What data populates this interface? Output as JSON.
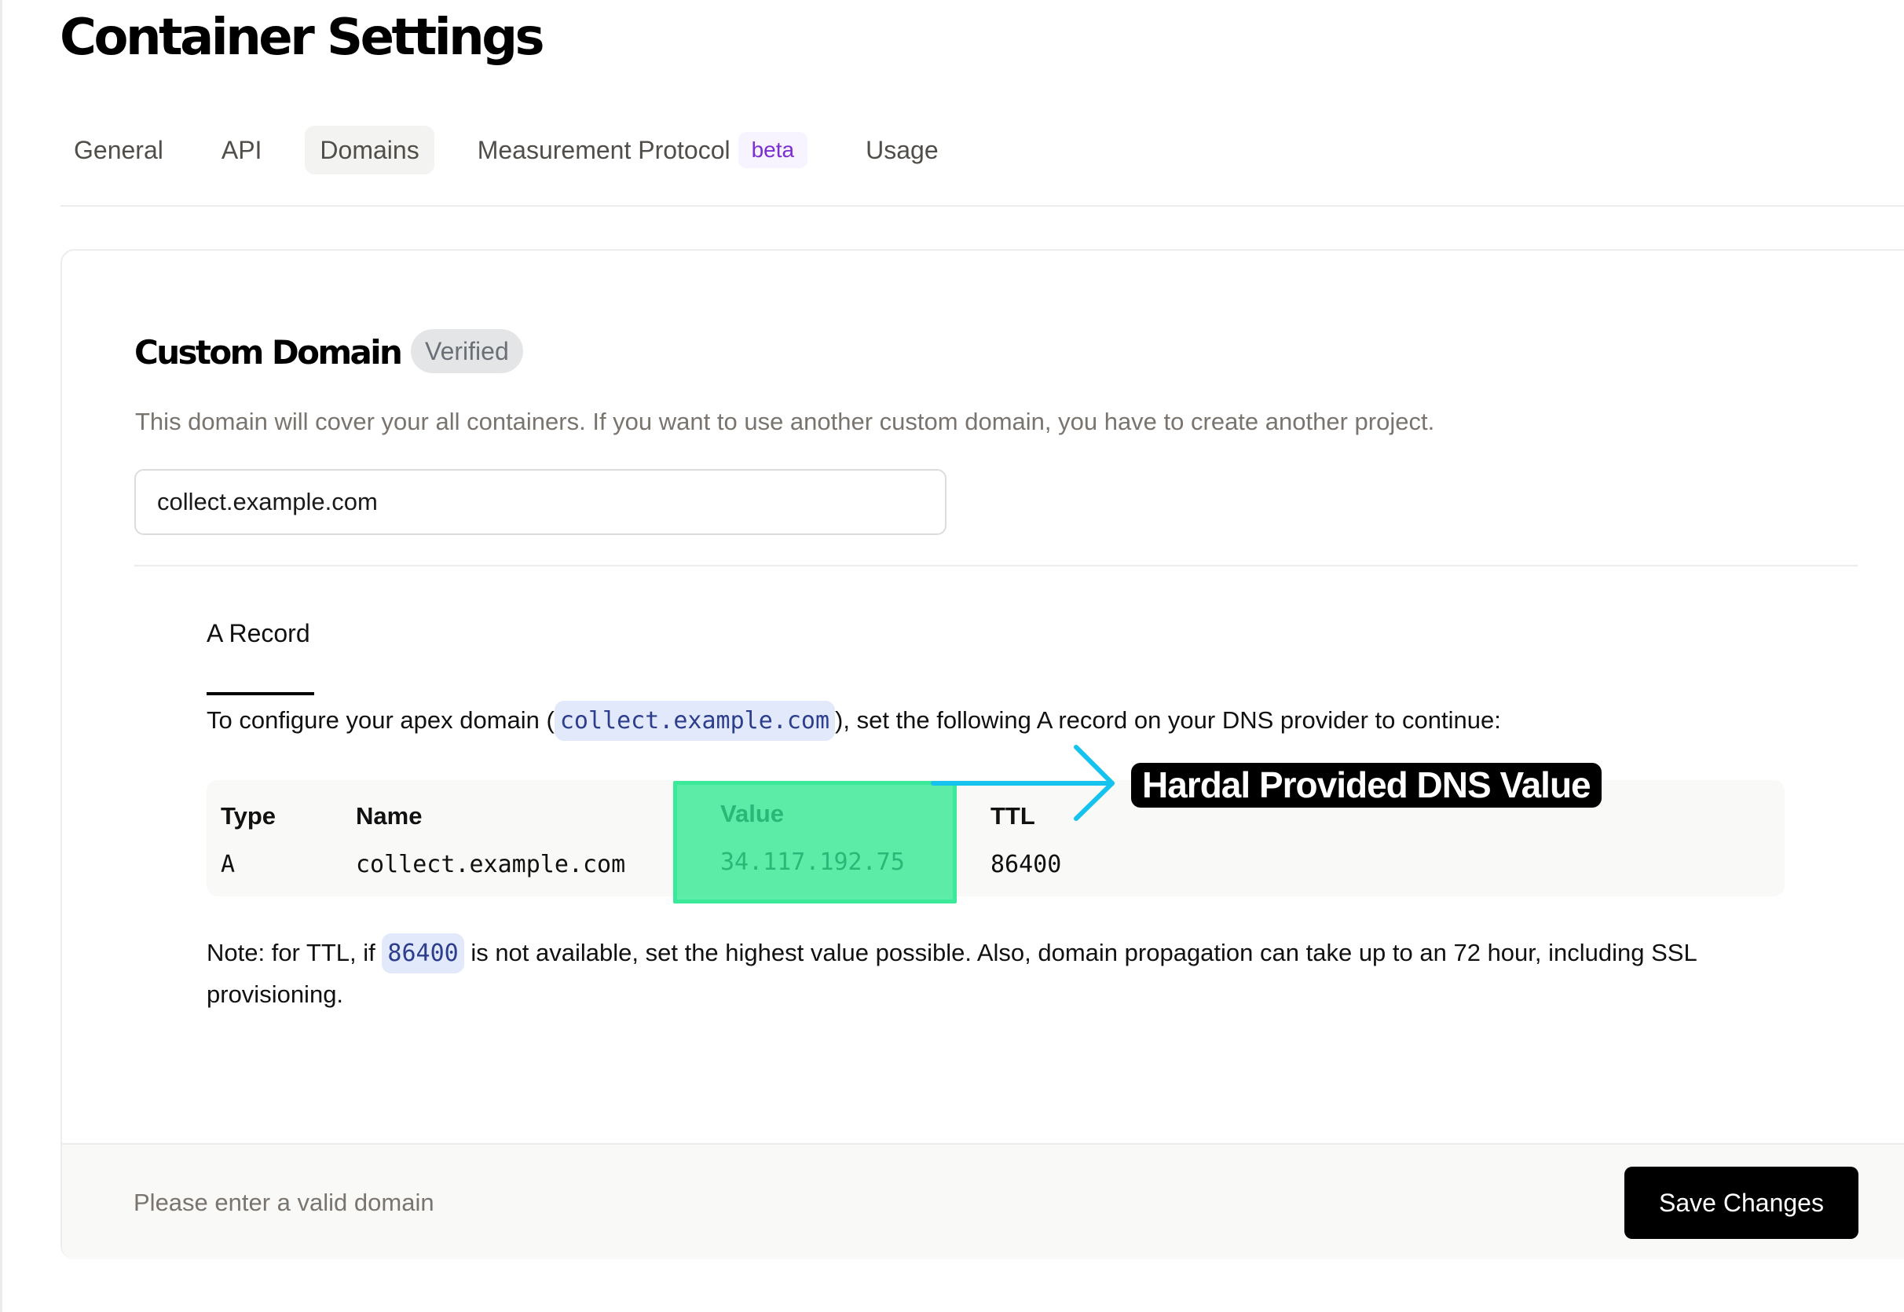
{
  "page": {
    "title": "Container Settings"
  },
  "tabs": [
    {
      "label": "General",
      "active": false
    },
    {
      "label": "API",
      "active": false
    },
    {
      "label": "Domains",
      "active": true
    },
    {
      "label": "Measurement Protocol",
      "badge": "beta",
      "active": false
    },
    {
      "label": "Usage",
      "active": false
    }
  ],
  "custom_domain": {
    "title": "Custom Domain",
    "status_badge": "Verified",
    "description": "This domain will cover your all containers. If you want to use another custom domain, you have to create another project.",
    "input_value": "collect.example.com"
  },
  "record": {
    "tab_label": "A Record",
    "instructions_before": "To configure your apex domain (",
    "instructions_domain": "collect.example.com",
    "instructions_after": "), set the following A record on your DNS provider to continue:",
    "table": {
      "headers": [
        "Type",
        "Name",
        "Value",
        "TTL"
      ],
      "rows": [
        [
          "A",
          "collect.example.com",
          "34.117.192.75",
          "86400"
        ]
      ]
    },
    "note_before": "Note: for TTL, if ",
    "note_code": "86400",
    "note_after": " is not available, set the highest value possible. Also, domain propagation can take up to an 72 hour, including SSL provisioning."
  },
  "annotation": {
    "label": "Hardal Provided DNS Value",
    "highlight_color": "#3be99a",
    "arrow_color": "#16c2ee"
  },
  "footer": {
    "message": "Please enter a valid domain",
    "save_label": "Save Changes"
  }
}
